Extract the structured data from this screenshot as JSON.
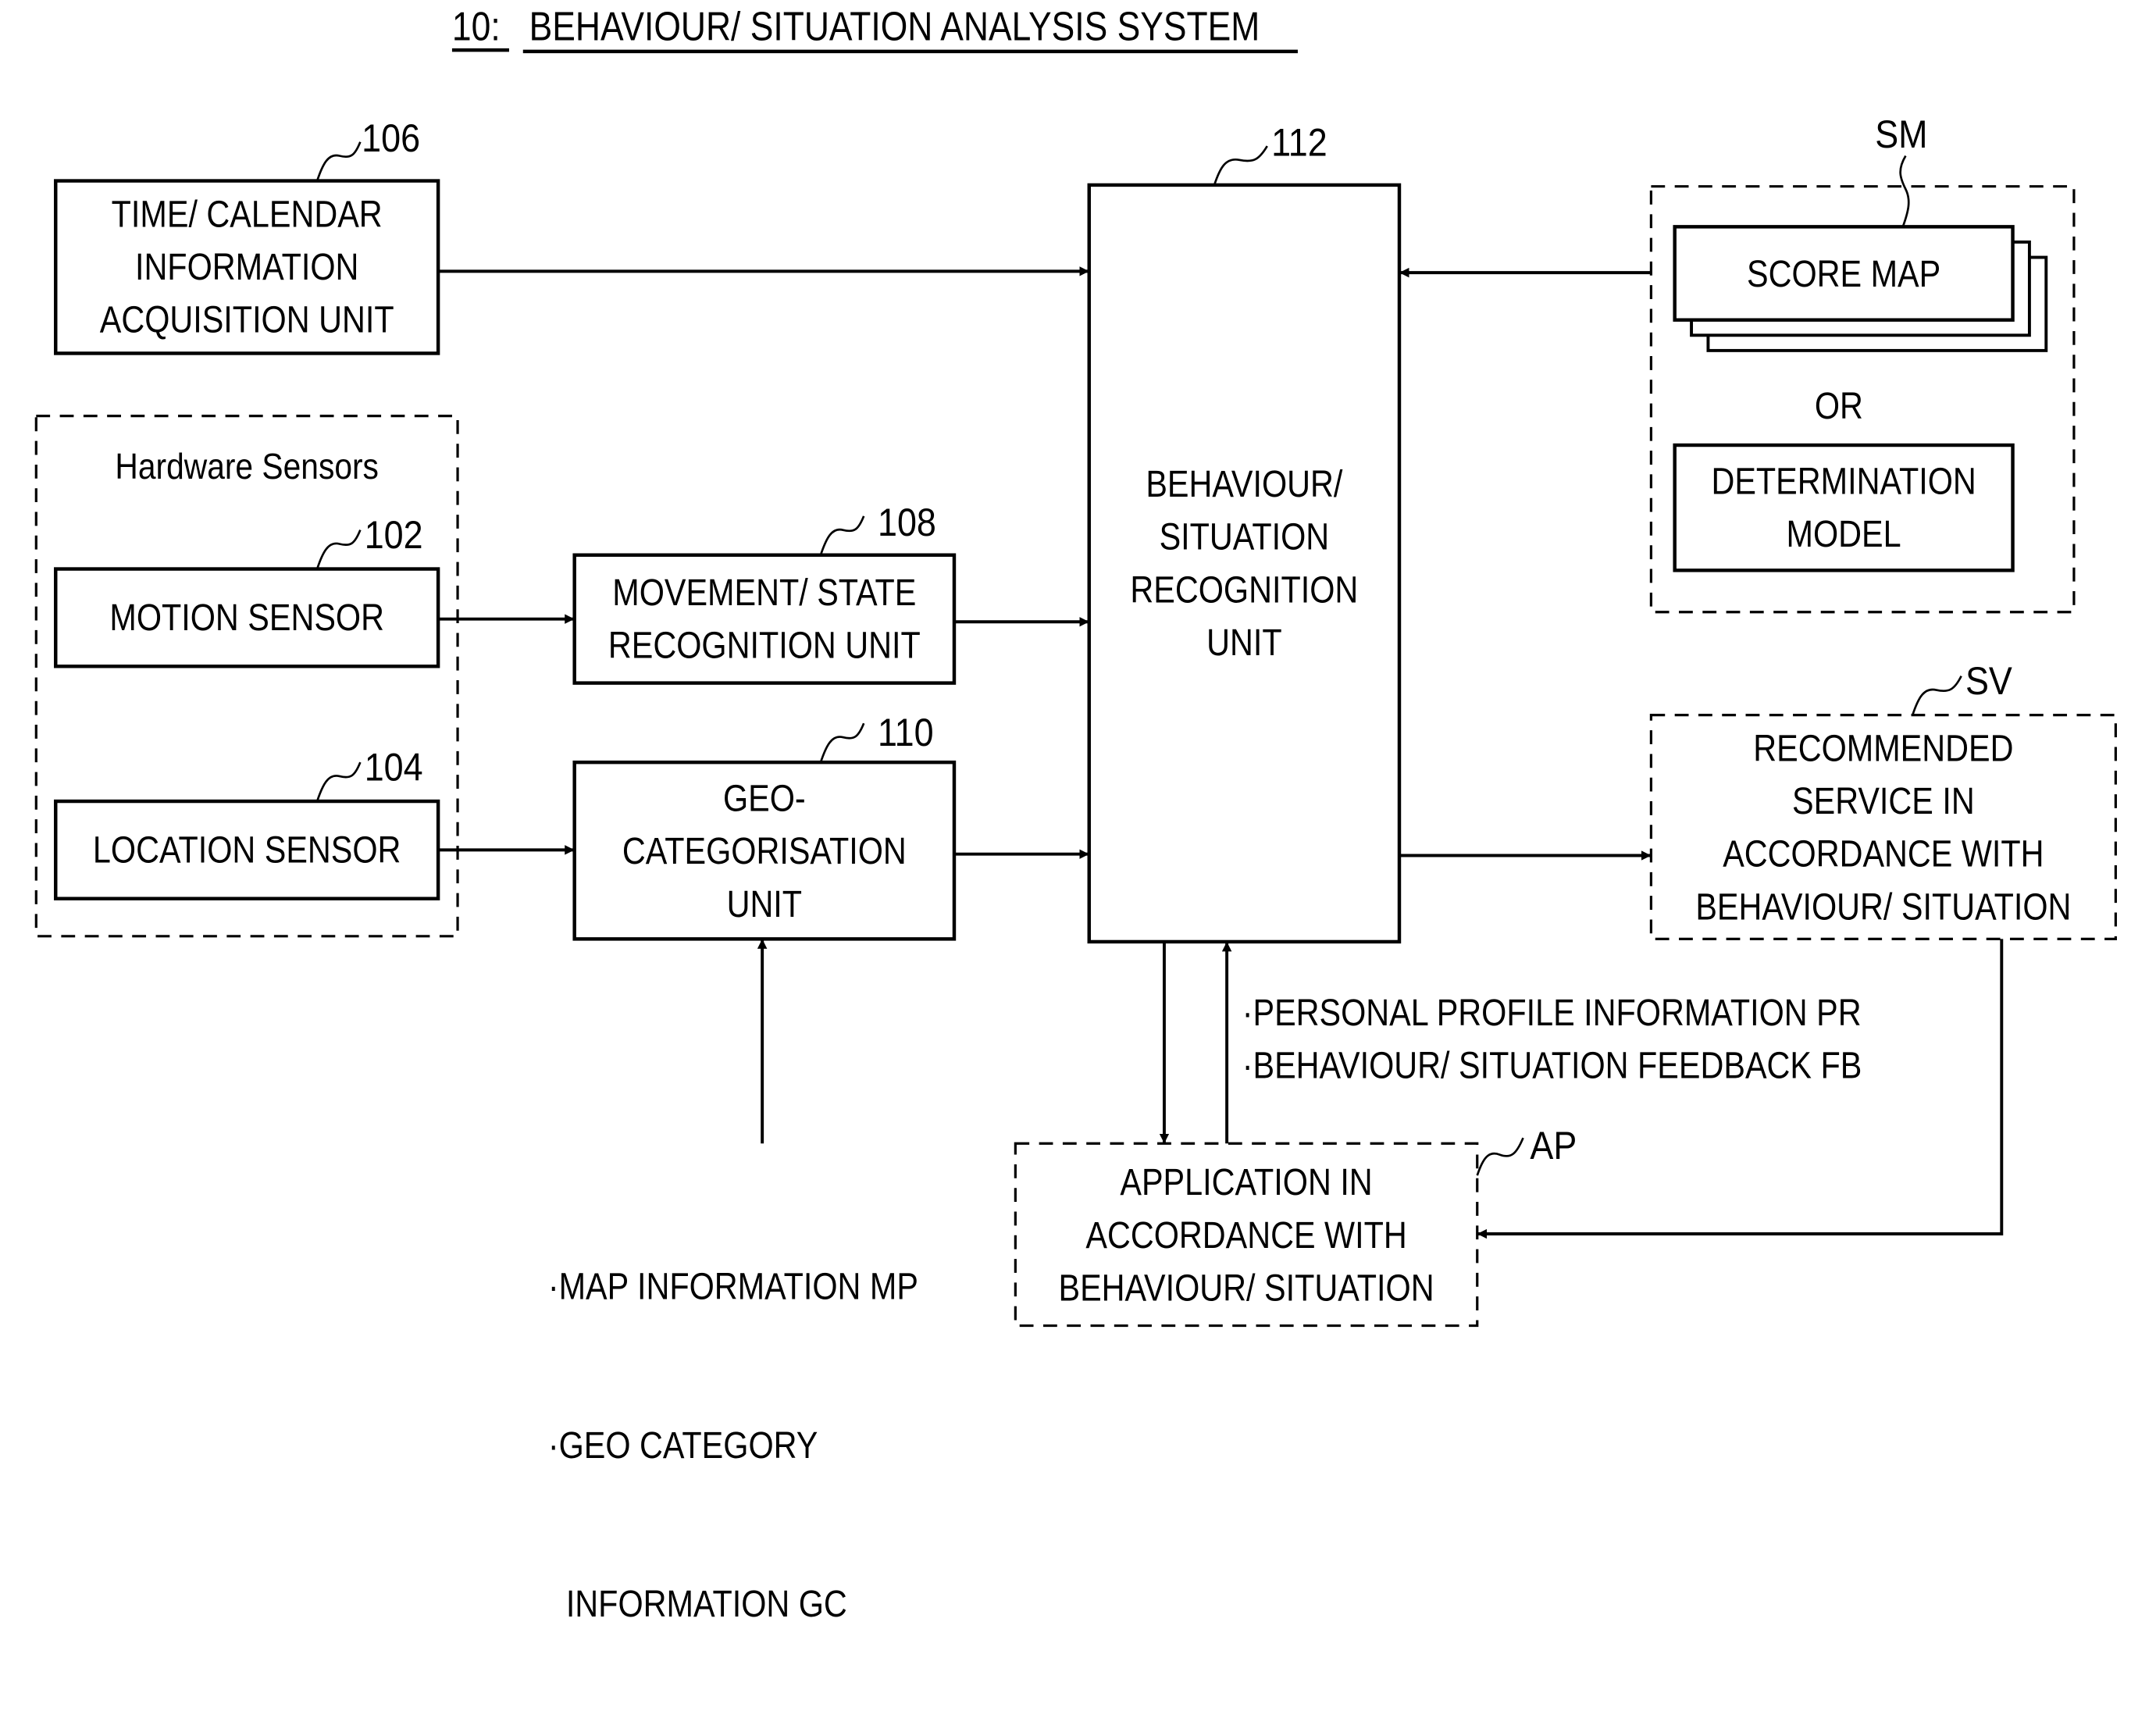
{
  "title": {
    "number": "10:",
    "text": "BEHAVIOUR/ SITUATION ANALYSIS SYSTEM"
  },
  "blocks": {
    "time_calendar": {
      "ref": "106",
      "lines": [
        "TIME/ CALENDAR",
        "INFORMATION",
        "ACQUISITION UNIT"
      ]
    },
    "hardware_sensors": {
      "label": "Hardware Sensors"
    },
    "motion_sensor": {
      "ref": "102",
      "lines": [
        "MOTION SENSOR"
      ]
    },
    "location_sensor": {
      "ref": "104",
      "lines": [
        "LOCATION SENSOR"
      ]
    },
    "movement_state": {
      "ref": "108",
      "lines": [
        "MOVEMENT/ STATE",
        "RECOGNITION UNIT"
      ]
    },
    "geo_categorisation": {
      "ref": "110",
      "lines": [
        "GEO-",
        "CATEGORISATION",
        "UNIT"
      ]
    },
    "behaviour_recognition": {
      "ref": "112",
      "lines": [
        "BEHAVIOUR/",
        "SITUATION",
        "RECOGNITION",
        "UNIT"
      ]
    },
    "score_map_group": {
      "ref": "SM",
      "score_map": "SCORE MAP",
      "or": "OR",
      "determination_model": [
        "DETERMINATION",
        "MODEL"
      ]
    },
    "recommended_service": {
      "ref": "SV",
      "lines": [
        "RECOMMENDED",
        "SERVICE IN",
        "ACCORDANCE WITH",
        "BEHAVIOUR/ SITUATION"
      ]
    },
    "application": {
      "ref": "AP",
      "lines": [
        "APPLICATION IN",
        "ACCORDANCE WITH",
        "BEHAVIOUR/ SITUATION"
      ]
    }
  },
  "annotations": {
    "profile_feedback": [
      "·PERSONAL PROFILE INFORMATION PR",
      "·BEHAVIOUR/ SITUATION FEEDBACK FB"
    ],
    "map_geo": [
      "·MAP INFORMATION MP",
      "·GEO CATEGORY",
      "  INFORMATION GC"
    ]
  }
}
